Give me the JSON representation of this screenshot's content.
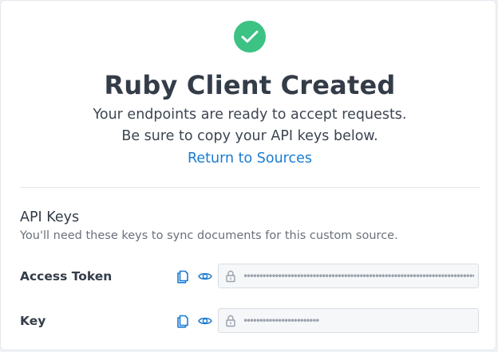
{
  "header": {
    "status_icon": "check-icon",
    "title": "Ruby Client Created",
    "subtitle_line1": "Your endpoints are ready to accept requests.",
    "subtitle_line2": "Be sure to copy your API keys below.",
    "return_link": "Return to Sources"
  },
  "api_keys": {
    "title": "API Keys",
    "description": "You'll need these keys to sync documents for this custom source.",
    "rows": [
      {
        "label": "Access Token",
        "copy_icon": "copy-icon",
        "reveal_icon": "eye-icon",
        "value": "••••••••••••••••••••••••••••••••••••••••••••••••••••••••••••••••••••••••••••••••••••••••••••••••••••"
      },
      {
        "label": "Key",
        "copy_icon": "copy-icon",
        "reveal_icon": "eye-icon",
        "value": "••••••••••••••••••••••••"
      }
    ]
  },
  "colors": {
    "success": "#3cc283",
    "link": "#1a7bd2",
    "icon_blue": "#1a7bd2",
    "text_dark": "#343c48",
    "text_muted": "#69707b"
  }
}
